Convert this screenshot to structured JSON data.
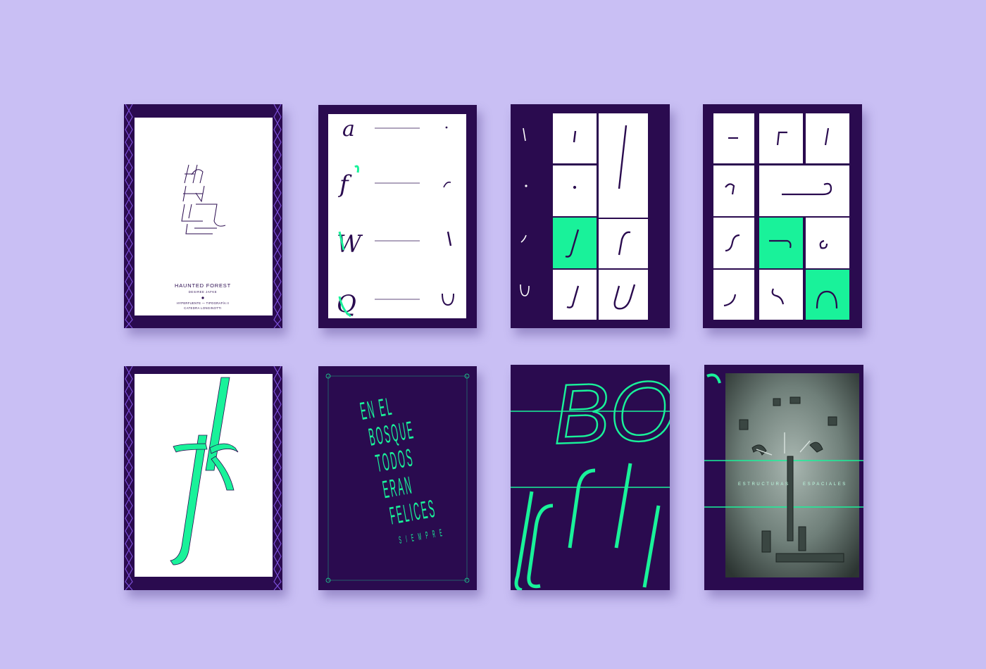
{
  "colors": {
    "background": "#c9bff4",
    "dark_purple": "#2a0b4f",
    "violet": "#7b4fd6",
    "mint": "#19f29a",
    "white": "#ffffff"
  },
  "cover_poster": {
    "title": "HAUNTED FOREST",
    "author": "DESIREE JAFKE",
    "course": "HYPERFUENTE — TIPOGRAFÍA II",
    "chair": "CATEDRA LONGINOTTI"
  },
  "glyph_poster": {
    "letters": [
      "a",
      "f",
      "W",
      "Q"
    ]
  },
  "forest_poster": {
    "lines": [
      "EN EL",
      "BOSQUE",
      "TODOS",
      "ERAN",
      "FELICES"
    ],
    "tagline": "SIEMPRE"
  },
  "bosque_poster": {
    "word": "BOSQUE"
  },
  "photo_poster": {
    "caption_left": "ESTRUCTURAS",
    "caption_right": "ESPACIALES"
  }
}
